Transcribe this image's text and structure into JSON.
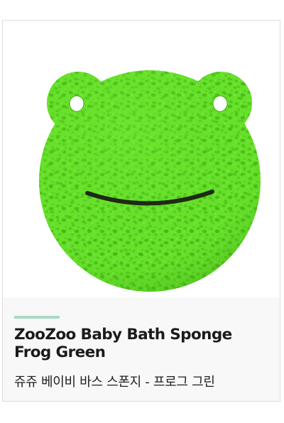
{
  "product": {
    "title": "ZooZoo Baby Bath Sponge Frog Green",
    "subtitle": "쥬쥬 베이비 바스 스폰지 - 프로그 그린",
    "image_subject": "frog-face-green-sponge",
    "colors": {
      "sponge": "#66e02a",
      "sponge_dark": "#3fae12",
      "accent_line": "#a9d9c4",
      "info_bg": "#f8f8f8",
      "border": "#dcdcdc",
      "text": "#1b1b1b"
    }
  }
}
